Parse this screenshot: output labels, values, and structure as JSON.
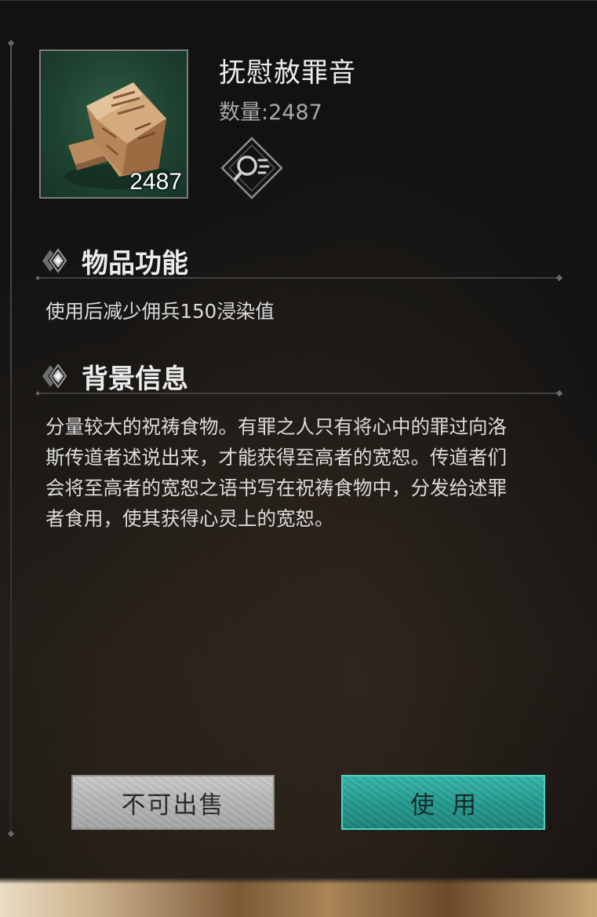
{
  "item": {
    "name": "抚慰赦罪音",
    "quantity_label": "数量:2487",
    "count_badge": "2487",
    "image_icon": "bread-loaf-icon",
    "inspect_icon": "magnifier-list-icon"
  },
  "sections": {
    "function": {
      "title": "物品功能",
      "icon": "diamond-emblem-icon",
      "text": "使用后减少佣兵150浸染值"
    },
    "background": {
      "title": "背景信息",
      "icon": "diamond-emblem-icon",
      "lines": [
        "分量较大的祝祷食物。有罪之人只有将心中的罪过向洛",
        "斯传道者述说出来，才能获得至高者的宽恕。传道者们",
        "会将至高者的宽恕之语书写在祝祷食物中，分发给述罪",
        "者食用，使其获得心灵上的宽恕。"
      ]
    }
  },
  "buttons": {
    "no_sell": "不可出售",
    "use": "使用"
  },
  "colors": {
    "panel_bg": "#141312",
    "item_bg": "#1f4332",
    "use_button": "#259a8f",
    "no_sell_button": "#b9b9b9",
    "title_text": "#eeeeee",
    "muted_text": "#a8a8a8"
  }
}
